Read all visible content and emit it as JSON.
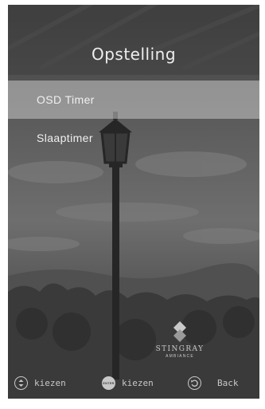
{
  "screen": {
    "title": "Opstelling"
  },
  "menu": {
    "items": [
      {
        "label": "OSD Timer",
        "selected": true
      },
      {
        "label": "Slaaptimer",
        "selected": false
      }
    ]
  },
  "branding": {
    "name": "STINGRAY",
    "subtitle": "AMBIANCE"
  },
  "footer": {
    "hints": [
      {
        "icon": "up-down-icon",
        "label": "kiezen"
      },
      {
        "icon": "enter-icon",
        "label": "kiezen",
        "icon_text": "ENTER"
      },
      {
        "icon": "back-icon",
        "label": "Back"
      }
    ]
  },
  "colors": {
    "highlight": "#b8b8b8",
    "text": "#f0f0f0"
  }
}
